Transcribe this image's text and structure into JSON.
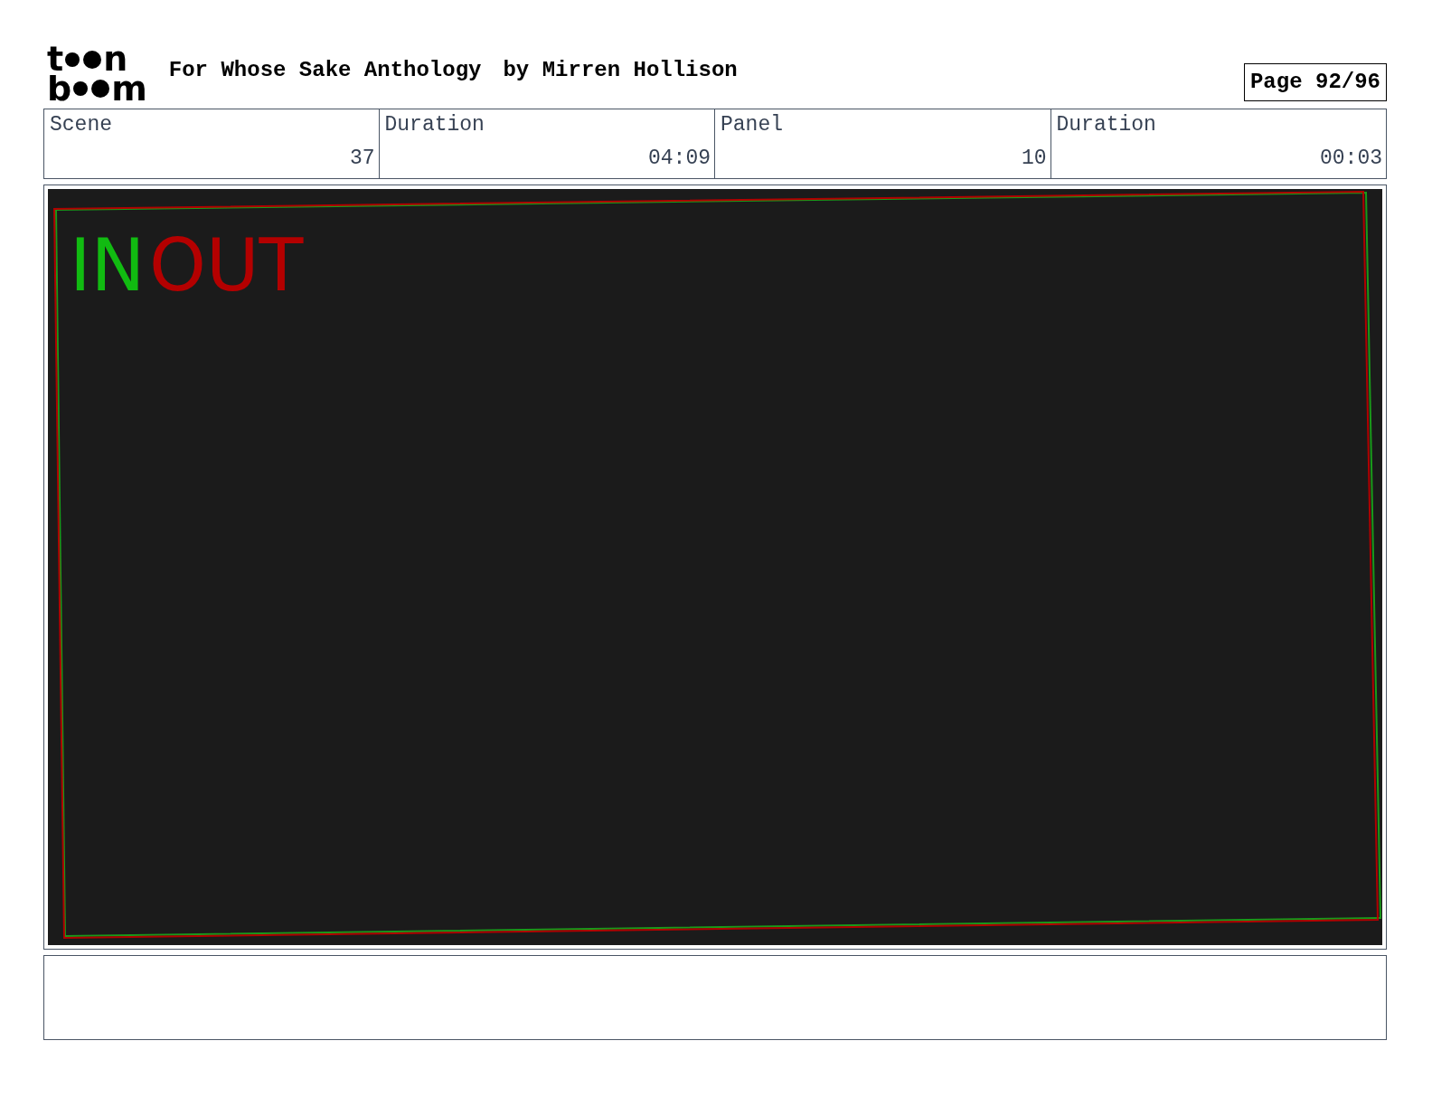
{
  "logo": {
    "lines": [
      [
        "t",
        "n"
      ],
      [
        "b",
        "m"
      ]
    ]
  },
  "title": "For Whose Sake Anthology",
  "author": "by Mirren Hollison",
  "page": "Page 92/96",
  "info_table": {
    "columns": [
      "Scene",
      "Duration",
      "Panel",
      "Duration"
    ],
    "rows": [
      [
        "37",
        "04:09",
        "10",
        "00:03"
      ]
    ]
  },
  "panel": {
    "in_label": "IN",
    "out_label": "OUT"
  }
}
